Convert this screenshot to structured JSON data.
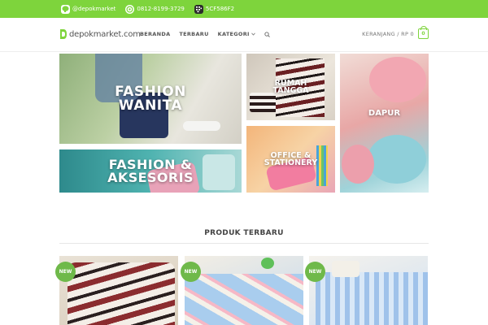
{
  "topbar": {
    "line": "@depokmarket",
    "whatsapp": "0812-8199-3729",
    "bbm": "5CF586F2"
  },
  "header": {
    "logo": "depokmarket.com",
    "nav": [
      {
        "label": "BERANDA"
      },
      {
        "label": "TERBARU"
      },
      {
        "label": "KATEGORI"
      }
    ],
    "cart_label": "KERANJANG / RP 0",
    "cart_count": "0"
  },
  "banners": [
    {
      "label": "FASHION\nWANITA"
    },
    {
      "label": "FASHION &\nAKSESORIS"
    },
    {
      "label": "RUMAH\nTANGGA"
    },
    {
      "label": "OFFICE &\nSTATIONERY"
    },
    {
      "label": "DAPUR"
    }
  ],
  "section": {
    "title": "PRODUK TERBARU"
  },
  "products": [
    {
      "badge": "NEW"
    },
    {
      "badge": "NEW"
    },
    {
      "badge": "NEW"
    }
  ],
  "colors": {
    "accent": "#7ed43c",
    "badge": "#6fb94a"
  }
}
